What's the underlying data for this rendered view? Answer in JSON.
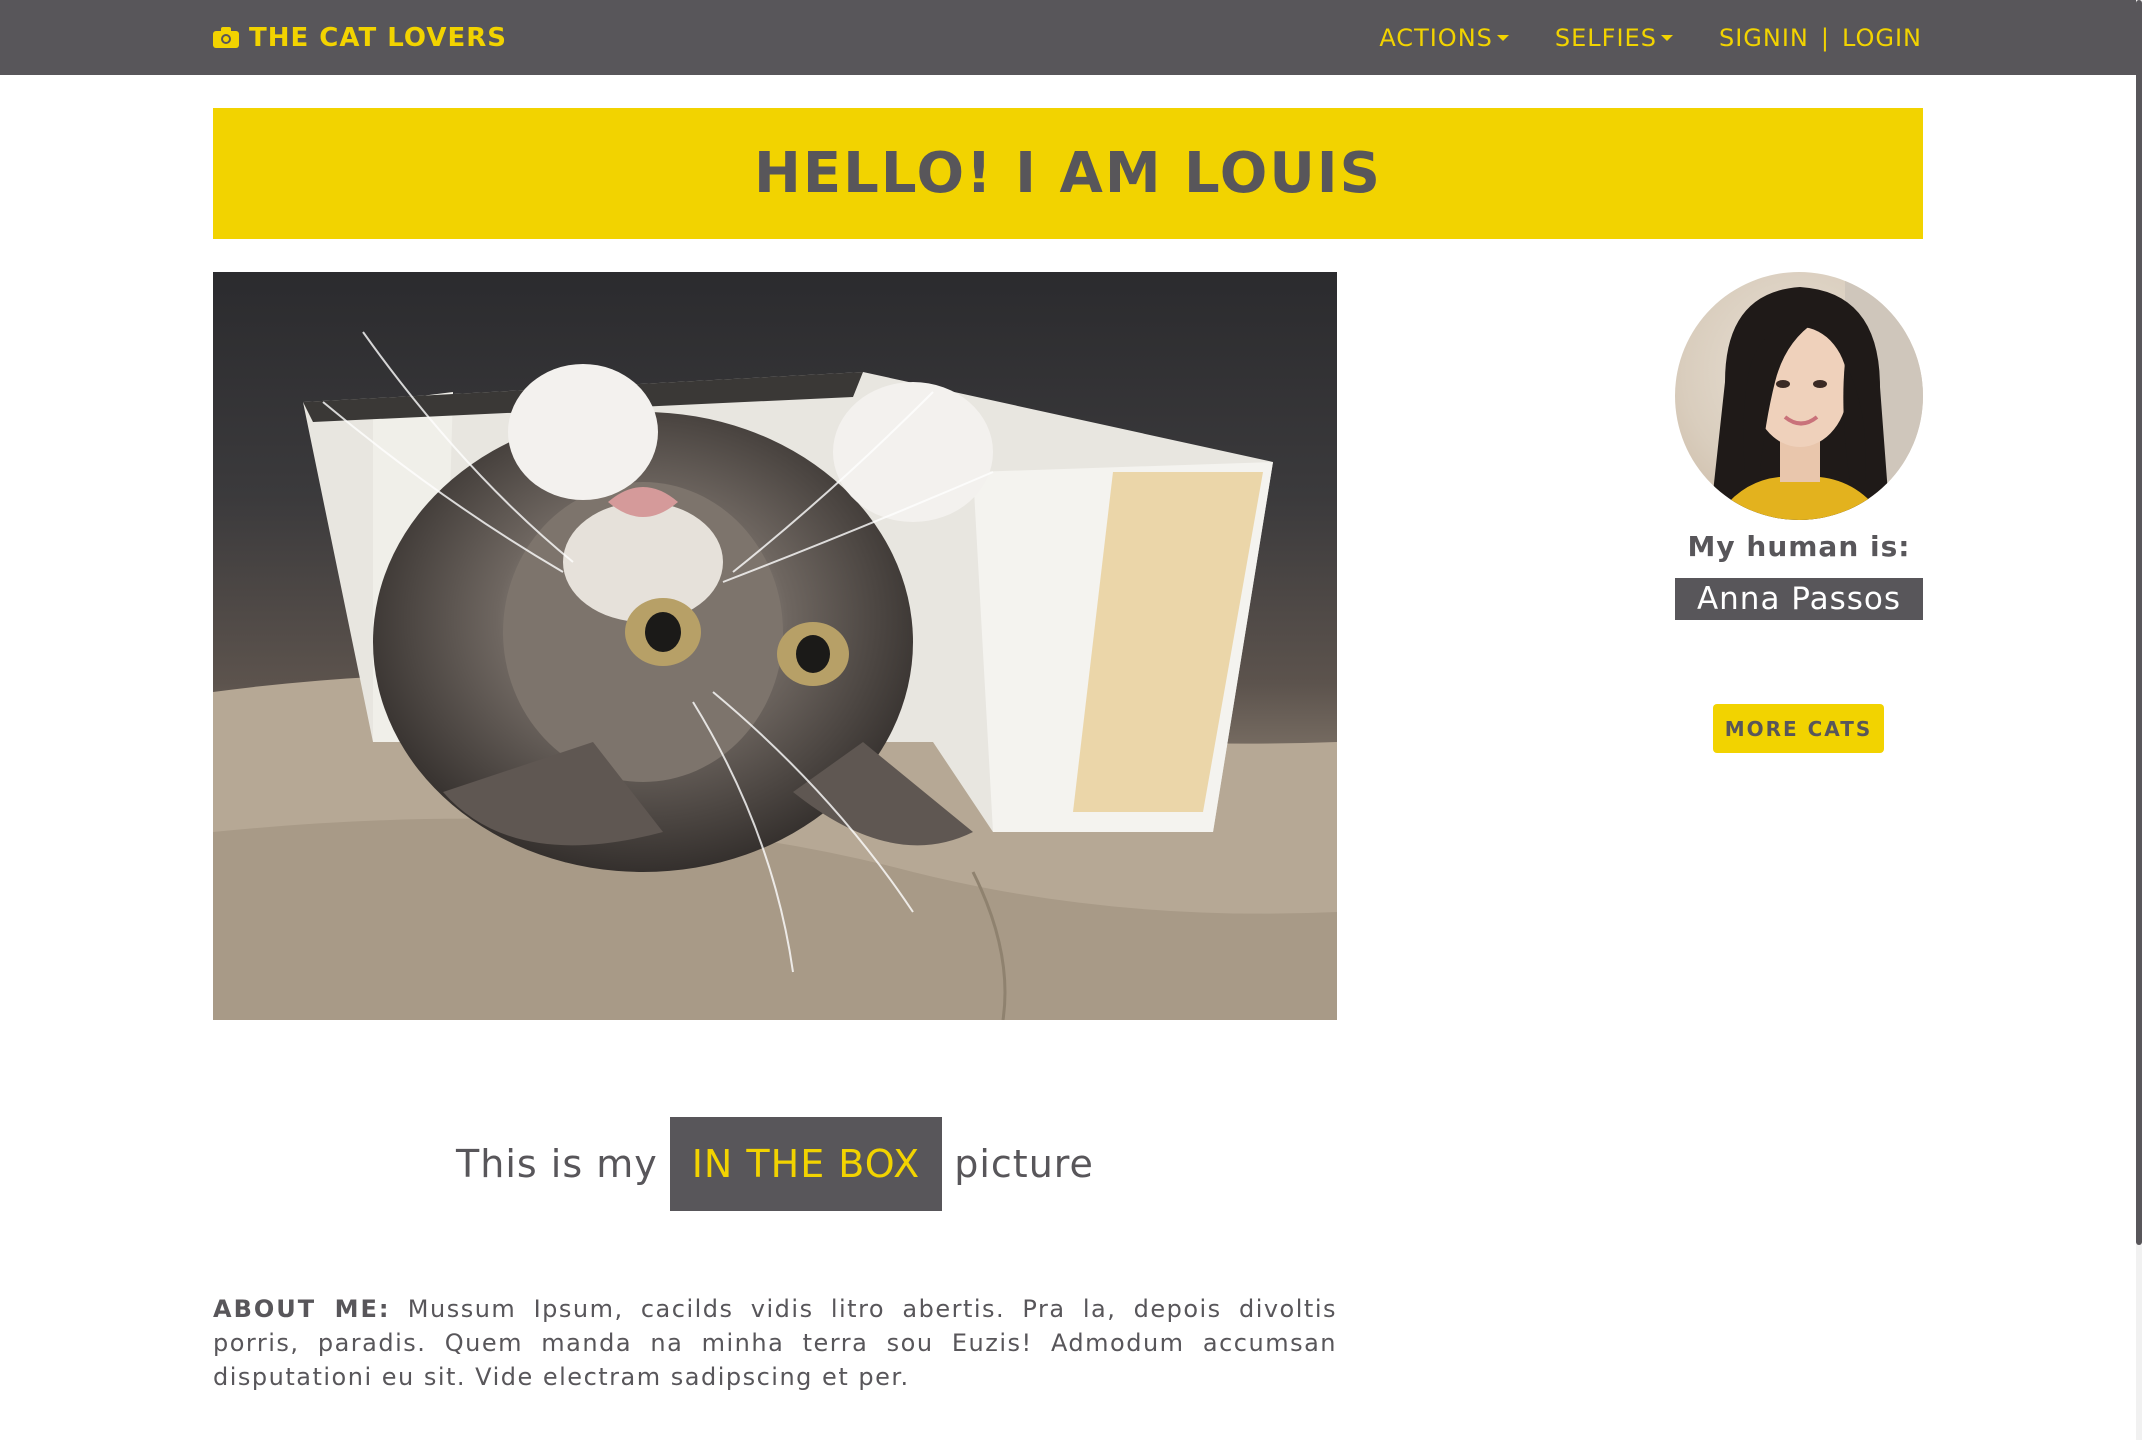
{
  "colors": {
    "accent": "#f2d300",
    "dark": "#58565a",
    "background": "#ffffff"
  },
  "navbar": {
    "brand_icon": "camera-icon",
    "brand": "THE CAT LOVERS",
    "actions": "ACTIONS",
    "selfies": "SELFIES",
    "signin": "SIGNIN",
    "separator": "|",
    "login": "LOGIN"
  },
  "banner": {
    "title": "HELLO! I AM LOUIS"
  },
  "photo": {
    "alt": "Tabby kitten lying upside down inside a cardboard box"
  },
  "caption": {
    "before": "This is my",
    "tag": "IN THE BOX",
    "after": "picture"
  },
  "about": {
    "label": "ABOUT ME:",
    "text": "Mussum Ipsum, cacilds vidis litro abertis. Pra la, depois divoltis porris, paradis. Quem manda na minha terra sou Euzis! Admodum accumsan disputationi eu sit. Vide electram sadipscing et per."
  },
  "sidebar": {
    "avatar_alt": "Portrait of Anna Passos",
    "human_label": "My human is:",
    "human_name": "Anna Passos",
    "more_cats": "MORE CATS"
  }
}
